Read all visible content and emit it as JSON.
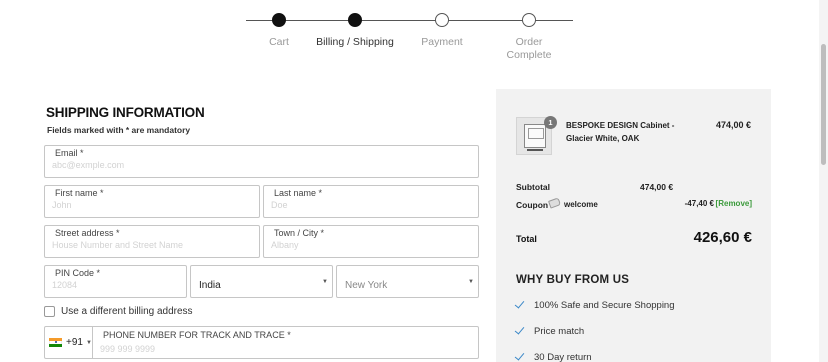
{
  "stepper": {
    "steps": [
      {
        "label": "Cart",
        "state": "done"
      },
      {
        "label": "Billing / Shipping",
        "state": "active"
      },
      {
        "label": "Payment",
        "state": "pending"
      },
      {
        "label": "Order Complete",
        "state": "pending"
      }
    ]
  },
  "form": {
    "title": "SHIPPING INFORMATION",
    "subtitle": "Fields marked with * are mandatory",
    "email": {
      "label": "Email *",
      "placeholder": "abc@exmple.com"
    },
    "first_name": {
      "label": "First name *",
      "placeholder": "John"
    },
    "last_name": {
      "label": "Last name *",
      "placeholder": "Doe"
    },
    "street": {
      "label": "Street address *",
      "placeholder": "House Number and Street Name"
    },
    "town": {
      "label": "Town / City *",
      "placeholder": "Albany"
    },
    "pin": {
      "label": "PIN Code *",
      "placeholder": "12084"
    },
    "country": {
      "value": "India"
    },
    "state": {
      "value": "New York"
    },
    "billing_checkbox": {
      "label": "Use a different billing address",
      "checked": false
    },
    "phone": {
      "country_code": "+91",
      "label": "PHONE NUMBER FOR TRACK AND TRACE *",
      "placeholder": "999 999 9999"
    }
  },
  "summary": {
    "item": {
      "name": "BESPOKE DESIGN Cabinet - Glacier White, OAK",
      "qty": "1",
      "price": "474,00 €"
    },
    "subtotal_label": "Subtotal",
    "subtotal_value": "474,00 €",
    "coupon_label": "Coupon",
    "coupon_code": "welcome",
    "discount": "-47,40 €",
    "remove_label": "[Remove]",
    "total_label": "Total",
    "total_value": "426,60 €",
    "why_title": "WHY BUY FROM US",
    "benefits": [
      "100% Safe and Secure Shopping",
      "Price match",
      "30 Day return"
    ]
  },
  "colors": {
    "accent_green": "#3b9a3b",
    "check_blue": "#3b88c8",
    "panel_bg": "#f2f2f2"
  }
}
